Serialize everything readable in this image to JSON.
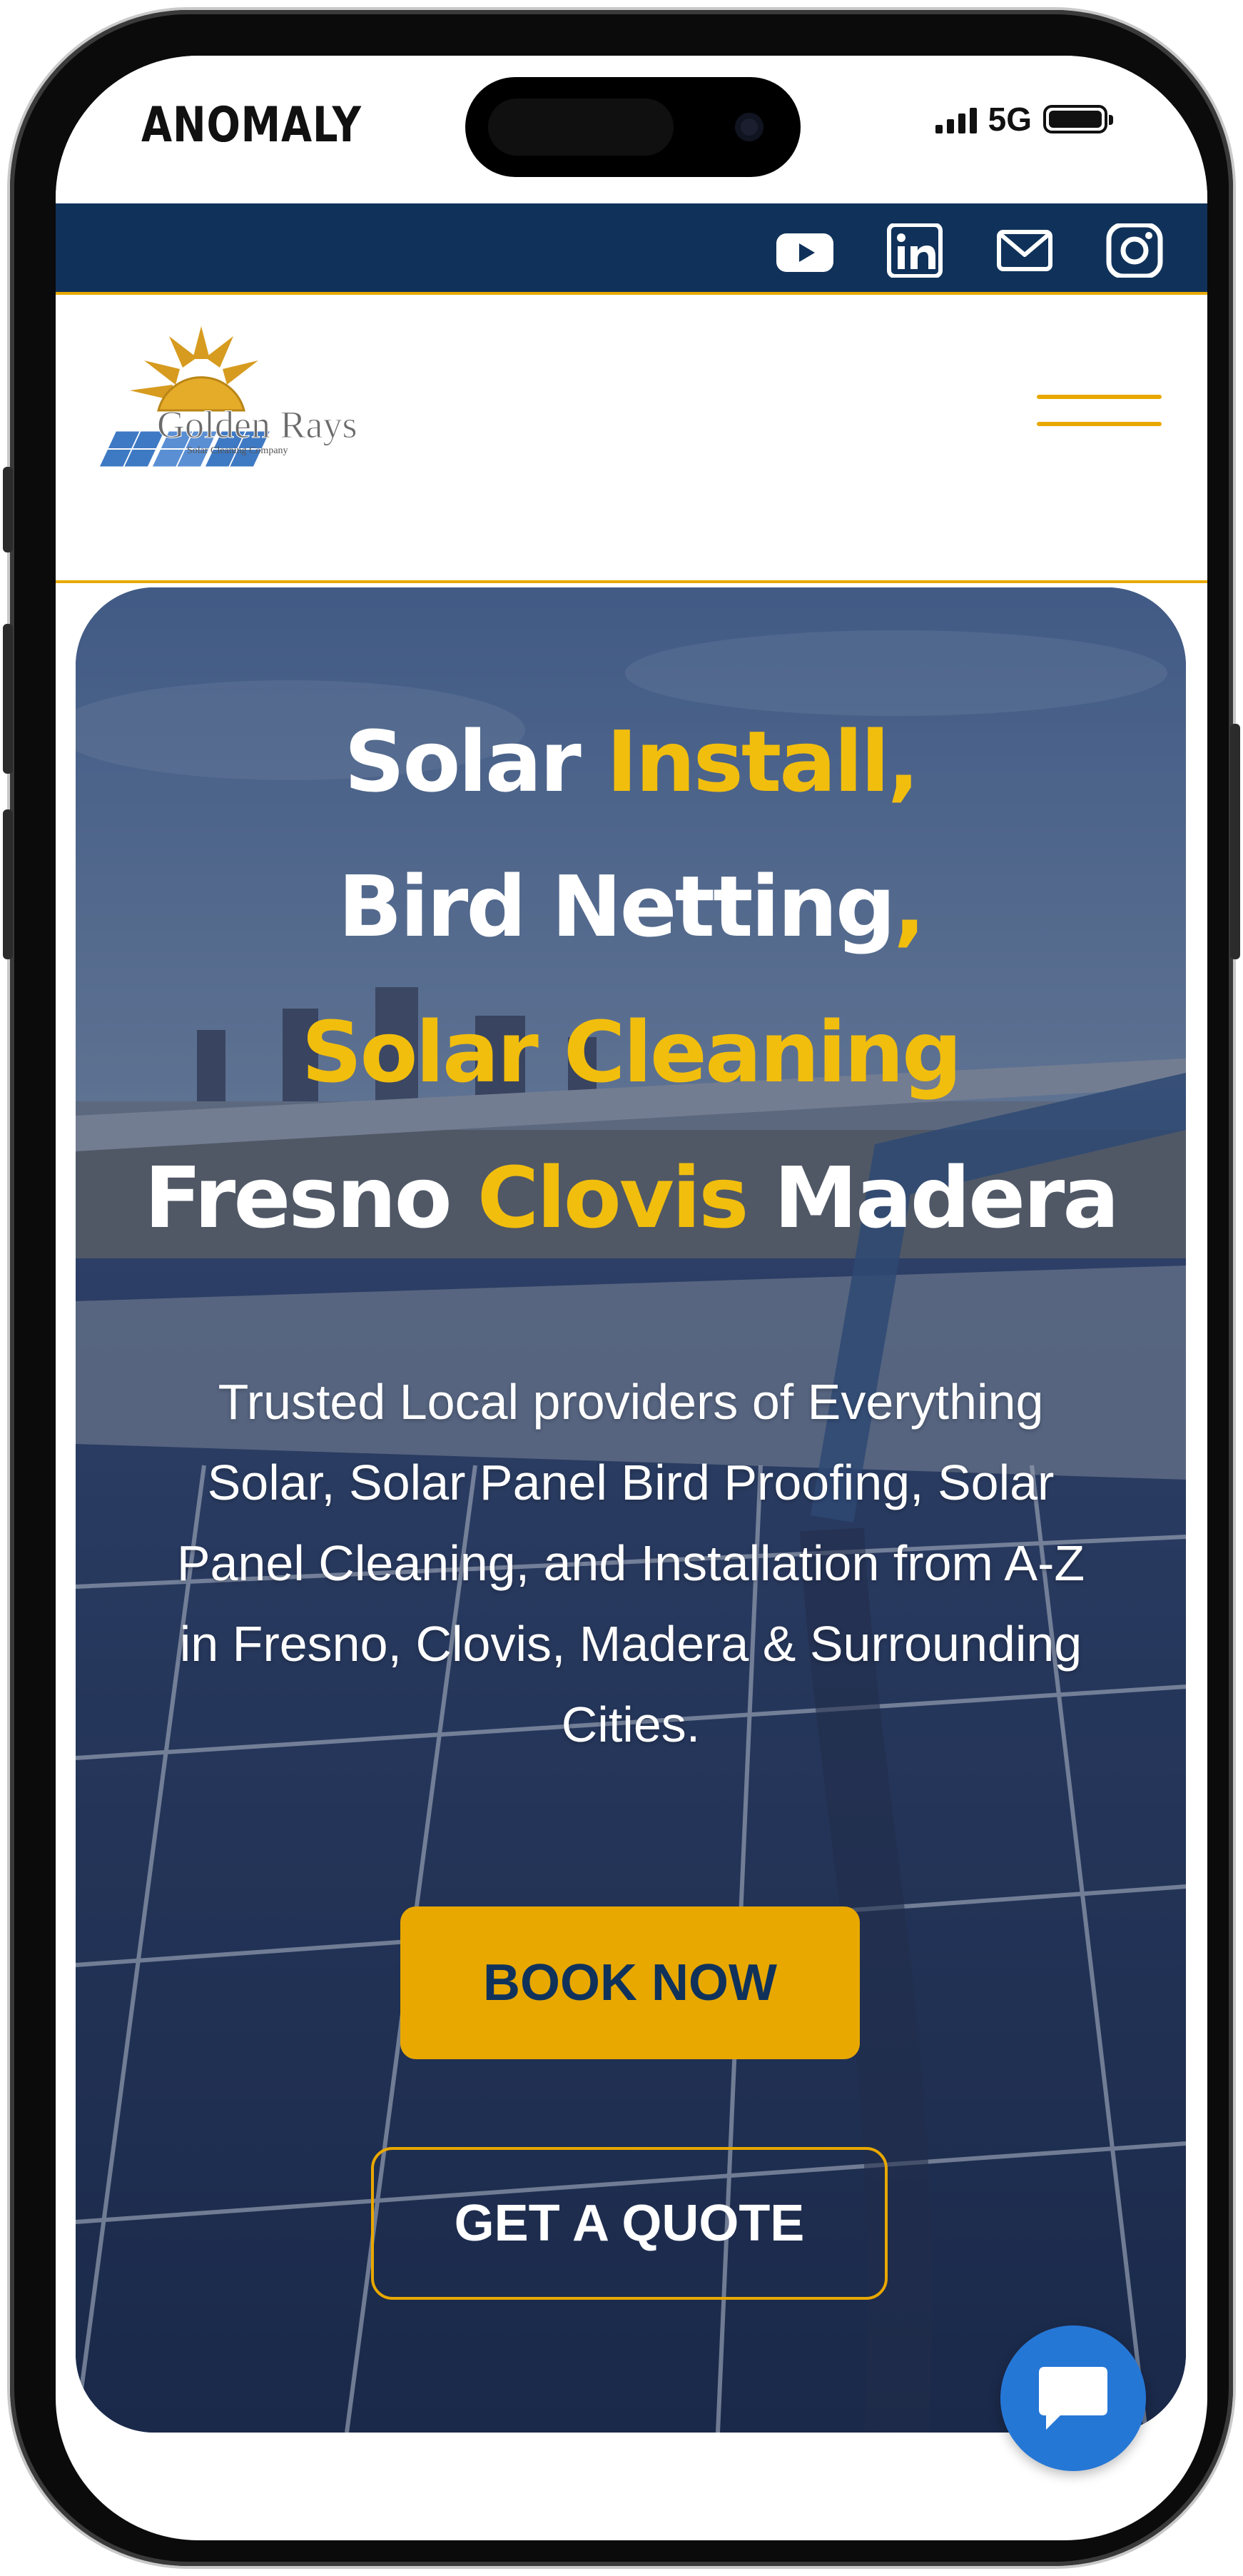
{
  "status_bar": {
    "carrier": "ANOMALY",
    "network": "5G"
  },
  "social": [
    "youtube-icon",
    "linkedin-icon",
    "mail-icon",
    "instagram-icon"
  ],
  "logo": {
    "text": "Golden Rays",
    "tagline": "Solar Cleaning Company"
  },
  "hero": {
    "line1": {
      "white": "Solar ",
      "yellow": "Install,"
    },
    "line2": {
      "white": "Bird Netting",
      "yellow": ","
    },
    "line3": {
      "yellow": "Solar Cleaning"
    },
    "line4": {
      "white_a": "Fresno ",
      "yellow": "Clovis",
      "white_b": " Madera"
    },
    "description": "Trusted Local providers of Everything Solar, Solar Panel Bird Proofing, Solar Panel Cleaning, and Installation from A-Z in Fresno, Clovis, Madera & Surrounding Cities.",
    "book_label": "BOOK NOW",
    "quote_label": "GET A QUOTE"
  },
  "colors": {
    "navy": "#10325a",
    "gold": "#e8a800",
    "headline_yellow": "#f2be0d",
    "chat_blue": "#2577d6"
  }
}
